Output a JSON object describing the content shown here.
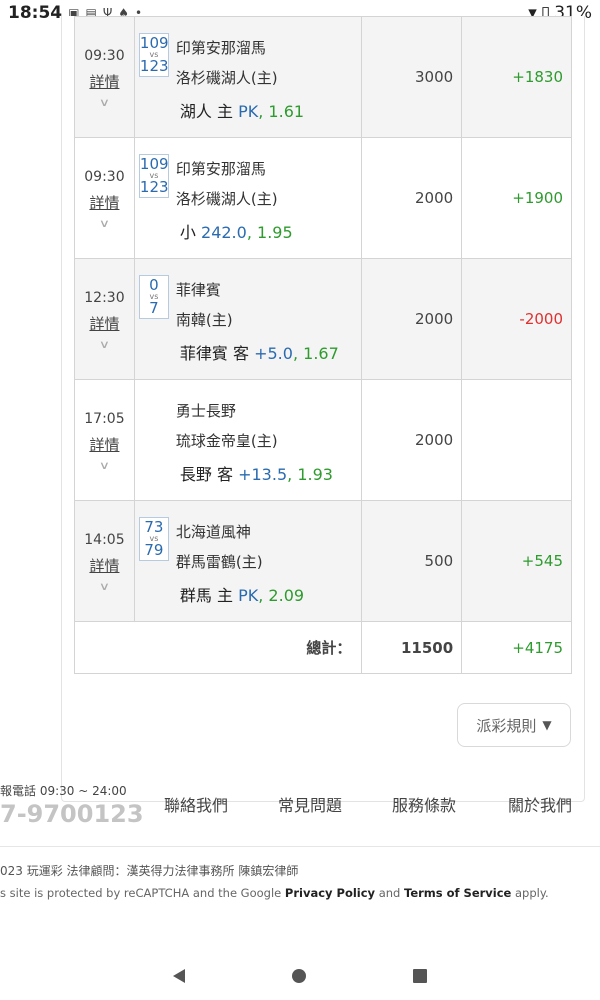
{
  "status_bar": {
    "time": "18:54",
    "icons": [
      "ame-icon",
      "file-icon",
      "usb-icon",
      "bell-icon",
      "dot-icon"
    ],
    "battery": "31%"
  },
  "bets": [
    {
      "time": "09:30",
      "detail": "詳情",
      "score_home": "109",
      "vs": "vs",
      "score_away": "123",
      "team1": "印第安那溜馬",
      "team2": "洛杉磯湖人(主)",
      "pick_team": "湖人 主",
      "pick_line": "PK",
      "pick_odds": "1.61",
      "amount": "3000",
      "result": "+1830",
      "result_type": "win"
    },
    {
      "time": "09:30",
      "detail": "詳情",
      "score_home": "109",
      "vs": "vs",
      "score_away": "123",
      "team1": "印第安那溜馬",
      "team2": "洛杉磯湖人(主)",
      "pick_team": "小",
      "pick_line": "242.0",
      "pick_odds": "1.95",
      "amount": "2000",
      "result": "+1900",
      "result_type": "win"
    },
    {
      "time": "12:30",
      "detail": "詳情",
      "score_home": "0",
      "vs": "vs",
      "score_away": "7",
      "team1": "菲律賓",
      "team2": "南韓(主)",
      "pick_team": "菲律賓 客",
      "pick_line": "+5.0",
      "pick_odds": "1.67",
      "amount": "2000",
      "result": "-2000",
      "result_type": "loss"
    },
    {
      "time": "17:05",
      "detail": "詳情",
      "score_home": "",
      "vs": "",
      "score_away": "",
      "team1": "勇士長野",
      "team2": "琉球金帝皇(主)",
      "pick_team": "長野 客",
      "pick_line": "+13.5",
      "pick_odds": "1.93",
      "amount": "2000",
      "result": "",
      "result_type": "pending"
    },
    {
      "time": "14:05",
      "detail": "詳情",
      "score_home": "73",
      "vs": "vs",
      "score_away": "79",
      "team1": "北海道風神",
      "team2": "群馬雷鶴(主)",
      "pick_team": "群馬 主",
      "pick_line": "PK",
      "pick_odds": "2.09",
      "amount": "500",
      "result": "+545",
      "result_type": "win"
    }
  ],
  "totals": {
    "label": "總計：",
    "amount": "11500",
    "result": "+4175"
  },
  "rules_button": {
    "label": "派彩規則",
    "icon": "triangle-down-icon"
  },
  "footer": {
    "hotline_label": "報電話 09:30 ~ 24:00",
    "hotline_number": "7-9700123",
    "links": [
      "聯絡我們",
      "常見問題",
      "服務條款",
      "關於我們"
    ],
    "copyright": "023 玩運彩 法律顧問：漢英得力法律事務所 陳鎮宏律師",
    "recaptcha_pre": "s site is protected by reCAPTCHA and the Google ",
    "privacy": "Privacy Policy",
    "and": " and ",
    "terms": "Terms of Service",
    "apply": " apply."
  },
  "colors": {
    "win": "#2e9b2e",
    "loss": "#e03030",
    "line": "#2a6bb0"
  }
}
